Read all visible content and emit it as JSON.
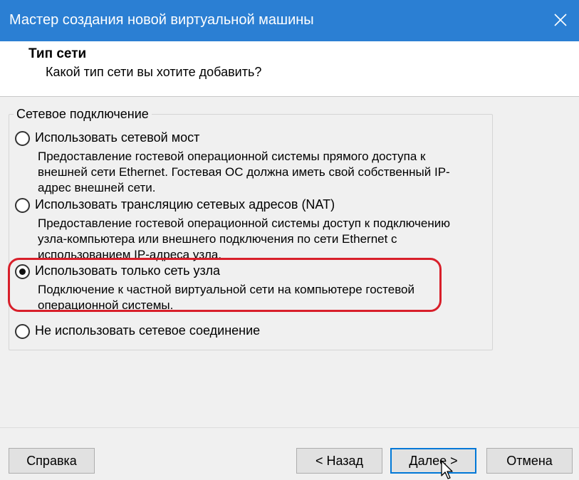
{
  "window": {
    "title": "Мастер создания новой виртуальной машины",
    "accent_color": "#2b7fd3"
  },
  "header": {
    "title": "Тип сети",
    "subtitle": "Какой тип сети вы хотите добавить?"
  },
  "group": {
    "legend": "Сетевое подключение",
    "options": [
      {
        "label": "Использовать сетевой мост",
        "description": "Предоставление гостевой операционной системы прямого доступа к внешней сети Ethernet. Гостевая ОС должна иметь свой собственный IP-адрес внешней сети.",
        "selected": false
      },
      {
        "label": "Использовать трансляцию сетевых адресов (NAT)",
        "description": "Предоставление гостевой операционной системы доступ к подключению узла-компьютера или внешнего подключения по сети Ethernet с использованием IP-адреса узла.",
        "selected": false
      },
      {
        "label": "Использовать только сеть узла",
        "description": "Подключение к частной виртуальной сети на компьютере гостевой операционной системы.",
        "selected": true
      },
      {
        "label": "Не использовать сетевое соединение",
        "description": "",
        "selected": false
      }
    ],
    "highlight_color": "#d81f2a"
  },
  "buttons": {
    "help": "Справка",
    "back": "< Назад",
    "next": "Далее >",
    "cancel": "Отмена"
  },
  "icons": {
    "close": "close-icon",
    "cursor": "mouse-pointer-icon"
  }
}
